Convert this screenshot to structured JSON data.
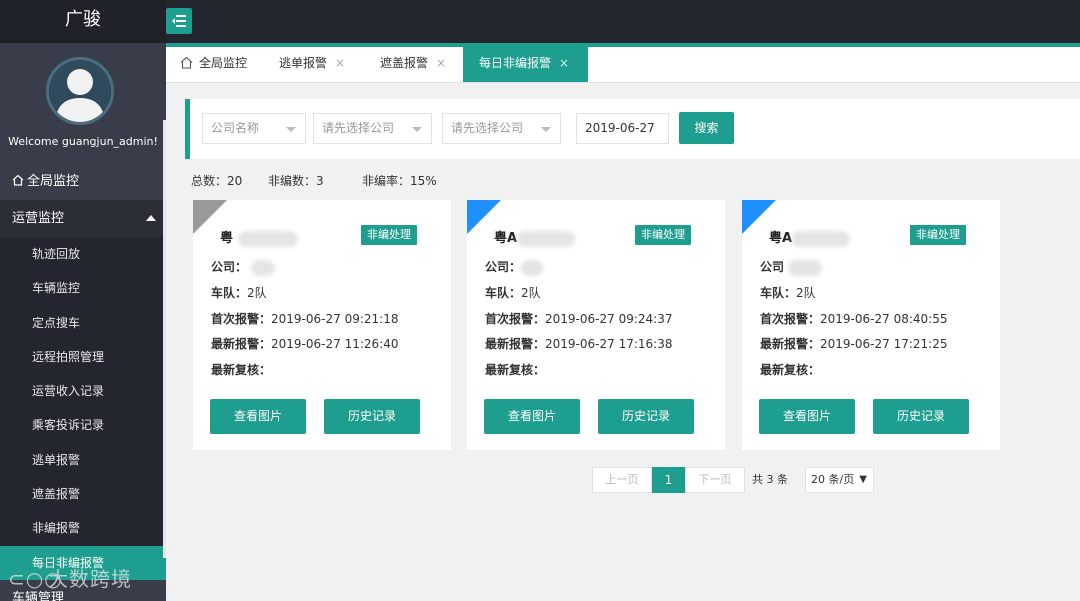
{
  "app": {
    "brand": "广骏"
  },
  "user": {
    "welcome": "Welcome guangjun_admin!"
  },
  "sidebar": {
    "home": "全局监控",
    "group": "运营监控",
    "items": [
      {
        "label": "轨迹回放"
      },
      {
        "label": "车辆监控"
      },
      {
        "label": "定点搜车"
      },
      {
        "label": "远程拍照管理"
      },
      {
        "label": "运营收入记录"
      },
      {
        "label": "乘客投诉记录"
      },
      {
        "label": "逃单报警"
      },
      {
        "label": "遮盖报警"
      },
      {
        "label": "非编报警"
      },
      {
        "label": "每日非编报警"
      }
    ],
    "next_group": "车辆管理"
  },
  "watermark": "大数跨境",
  "tabs": [
    {
      "label": "全局监控"
    },
    {
      "label": "逃单报警",
      "close": "×"
    },
    {
      "label": "遮盖报警",
      "close": "×"
    },
    {
      "label": "每日非编报警",
      "close": "×"
    }
  ],
  "search": {
    "company_placeholder": "公司名称",
    "select1_placeholder": "请先选择公司",
    "select2_placeholder": "请先选择公司",
    "date": "2019-06-27",
    "button": "搜索"
  },
  "stats": {
    "total": "总数：20",
    "nonedit": "非编数：3",
    "rate": "非编率：15%"
  },
  "cards": [
    {
      "plate": "粤",
      "badge": "非编处理",
      "company_label": "公司：",
      "team_label": "车队：",
      "team": "2队",
      "first_label": "首次报警：",
      "first": "2019-06-27 09:21:18",
      "last_label": "最新报警：",
      "last": "2019-06-27 11:26:40",
      "review_label": "最新复核：",
      "btn_photo": "查看图片",
      "btn_history": "历史记录",
      "corner_color": "#999999"
    },
    {
      "plate": "粤A",
      "badge": "非编处理",
      "company_label": "公司：",
      "team_label": "车队：",
      "team": "2队",
      "first_label": "首次报警：",
      "first": "2019-06-27 09:24:37",
      "last_label": "最新报警：",
      "last": "2019-06-27 17:16:38",
      "review_label": "最新复核：",
      "btn_photo": "查看图片",
      "btn_history": "历史记录",
      "corner_color": "#1e90ff"
    },
    {
      "plate": "粤A",
      "badge": "非编处理",
      "company_label": "公司",
      "team_label": "车队：",
      "team": "2队",
      "first_label": "首次报警：",
      "first": "2019-06-27 08:40:55",
      "last_label": "最新报警：",
      "last": "2019-06-27 17:21:25",
      "review_label": "最新复核：",
      "btn_photo": "查看图片",
      "btn_history": "历史记录",
      "corner_color": "#1e90ff"
    }
  ],
  "pagination": {
    "prev": "上一页",
    "current": "1",
    "next": "下一页",
    "total": "共 3 条",
    "page_size": "20 条/页",
    "page_size_arrow": "▼"
  },
  "colors": {
    "accent": "#1e9e8e",
    "sidebar": "#393d49",
    "topbar": "#23262e"
  }
}
